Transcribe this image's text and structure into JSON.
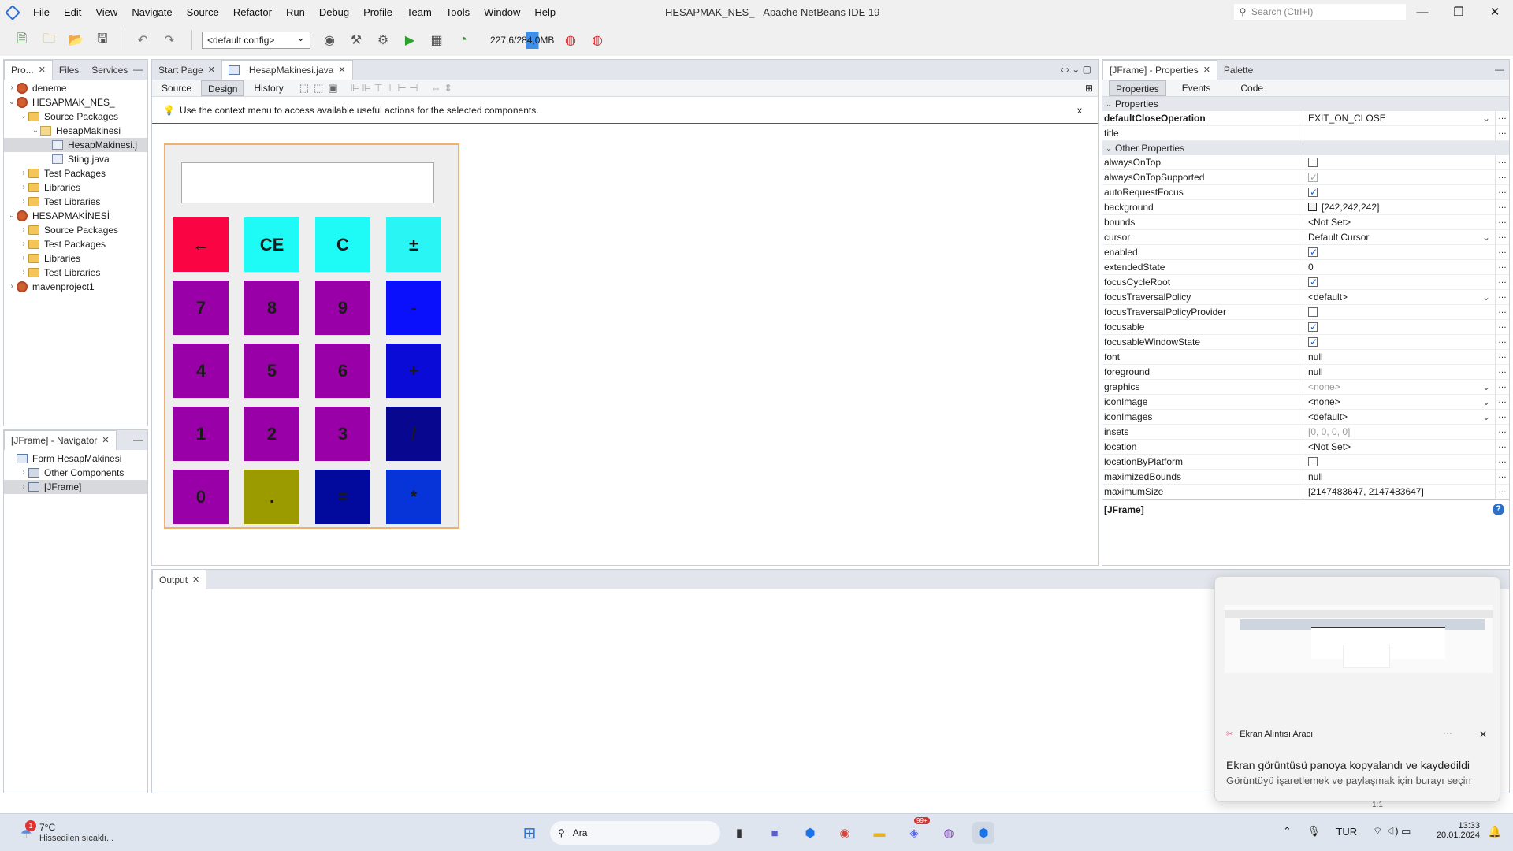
{
  "window": {
    "title": "HESAPMAK_NES_ - Apache NetBeans IDE 19",
    "menus": [
      "File",
      "Edit",
      "View",
      "Navigate",
      "Source",
      "Refactor",
      "Run",
      "Debug",
      "Profile",
      "Team",
      "Tools",
      "Window",
      "Help"
    ],
    "search_placeholder": "Search (Ctrl+I)"
  },
  "toolbar": {
    "config": "<default config>",
    "memory": "227,6/284,0MB"
  },
  "projects_panel": {
    "tabs": [
      "Pro...",
      "Files",
      "Services"
    ],
    "tree": [
      {
        "label": "deneme",
        "icon": "project-icon",
        "level": 0,
        "toggle": "›"
      },
      {
        "label": "HESAPMAK_NES_",
        "icon": "project-icon",
        "level": 0,
        "toggle": "⌄"
      },
      {
        "label": "Source Packages",
        "icon": "folder-icon",
        "level": 1,
        "toggle": "⌄"
      },
      {
        "label": "HesapMakinesi",
        "icon": "package-icon",
        "level": 2,
        "toggle": "⌄"
      },
      {
        "label": "HesapMakinesi.j",
        "icon": "java-file-icon",
        "level": 3,
        "toggle": "",
        "selected": true
      },
      {
        "label": "Sting.java",
        "icon": "java-file-icon",
        "level": 3,
        "toggle": ""
      },
      {
        "label": "Test Packages",
        "icon": "folder-icon",
        "level": 1,
        "toggle": "›"
      },
      {
        "label": "Libraries",
        "icon": "folder-icon",
        "level": 1,
        "toggle": "›"
      },
      {
        "label": "Test Libraries",
        "icon": "folder-icon",
        "level": 1,
        "toggle": "›"
      },
      {
        "label": "HESAPMAKİNESİ",
        "icon": "project-icon",
        "level": 0,
        "toggle": "⌄"
      },
      {
        "label": "Source Packages",
        "icon": "folder-icon",
        "level": 1,
        "toggle": "›"
      },
      {
        "label": "Test Packages",
        "icon": "folder-icon",
        "level": 1,
        "toggle": "›"
      },
      {
        "label": "Libraries",
        "icon": "folder-icon",
        "level": 1,
        "toggle": "›"
      },
      {
        "label": "Test Libraries",
        "icon": "folder-icon",
        "level": 1,
        "toggle": "›"
      },
      {
        "label": "mavenproject1",
        "icon": "project-icon",
        "level": 0,
        "toggle": "›"
      }
    ]
  },
  "navigator": {
    "tab": "[JFrame] - Navigator",
    "tree": [
      {
        "label": "Form HesapMakinesi",
        "icon": "form-icon",
        "level": 0,
        "toggle": ""
      },
      {
        "label": "Other Components",
        "icon": "frame-icon",
        "level": 1,
        "toggle": "›"
      },
      {
        "label": "[JFrame]",
        "icon": "frame-icon",
        "level": 1,
        "toggle": "›",
        "selected": true
      }
    ]
  },
  "editor": {
    "tabs": [
      "Start Page",
      "HesapMakinesi.java"
    ],
    "views": [
      "Source",
      "Design",
      "History"
    ],
    "info": "Use the context menu to access available useful actions for the selected components.",
    "info_close": "x"
  },
  "calculator": {
    "keys": [
      {
        "label": "←",
        "color": "#fb0444"
      },
      {
        "label": "CE",
        "color": "#1efbf6"
      },
      {
        "label": "C",
        "color": "#1efbf6"
      },
      {
        "label": "±",
        "color": "#2af5f5"
      },
      {
        "label": "7",
        "color": "#9a00a7"
      },
      {
        "label": "8",
        "color": "#9a00a7"
      },
      {
        "label": "9",
        "color": "#9a00a7"
      },
      {
        "label": "-",
        "color": "#0a10fb"
      },
      {
        "label": "4",
        "color": "#9a00a7"
      },
      {
        "label": "5",
        "color": "#9a00a7"
      },
      {
        "label": "6",
        "color": "#9a00a7"
      },
      {
        "label": "+",
        "color": "#0a0bd6"
      },
      {
        "label": "1",
        "color": "#9a00a7"
      },
      {
        "label": "2",
        "color": "#9a00a7"
      },
      {
        "label": "3",
        "color": "#9a00a7"
      },
      {
        "label": "/",
        "color": "#07088f"
      },
      {
        "label": "0",
        "color": "#9a00a7"
      },
      {
        "label": ".",
        "color": "#9b9b00"
      },
      {
        "label": "=",
        "color": "#020a9e"
      },
      {
        "label": "*",
        "color": "#0734d9"
      }
    ]
  },
  "properties": {
    "tabs": [
      "[JFrame] - Properties",
      "Palette"
    ],
    "subtabs": [
      "Properties",
      "Events",
      "Code"
    ],
    "section1": "Properties",
    "section2": "Other Properties",
    "rows1": [
      {
        "name": "defaultCloseOperation",
        "value": "EXIT_ON_CLOSE",
        "type": "dropdown",
        "bold": true
      },
      {
        "name": "title",
        "value": "",
        "type": "text"
      }
    ],
    "rows2": [
      {
        "name": "alwaysOnTop",
        "type": "check",
        "checked": false
      },
      {
        "name": "alwaysOnTopSupported",
        "type": "check",
        "checked": true,
        "disabled": true
      },
      {
        "name": "autoRequestFocus",
        "type": "check",
        "checked": true
      },
      {
        "name": "background",
        "value": "[242,242,242]",
        "type": "color"
      },
      {
        "name": "bounds",
        "value": "<Not Set>",
        "type": "text"
      },
      {
        "name": "cursor",
        "value": "Default Cursor",
        "type": "dropdown"
      },
      {
        "name": "enabled",
        "type": "check",
        "checked": true
      },
      {
        "name": "extendedState",
        "value": "0",
        "type": "text"
      },
      {
        "name": "focusCycleRoot",
        "type": "check",
        "checked": true
      },
      {
        "name": "focusTraversalPolicy",
        "value": "<default>",
        "type": "dropdown"
      },
      {
        "name": "focusTraversalPolicyProvider",
        "type": "check",
        "checked": false
      },
      {
        "name": "focusable",
        "type": "check",
        "checked": true
      },
      {
        "name": "focusableWindowState",
        "type": "check",
        "checked": true
      },
      {
        "name": "font",
        "value": "null",
        "type": "text"
      },
      {
        "name": "foreground",
        "value": "null",
        "type": "text"
      },
      {
        "name": "graphics",
        "value": "<none>",
        "type": "grey-dropdown"
      },
      {
        "name": "iconImage",
        "value": "<none>",
        "type": "dropdown"
      },
      {
        "name": "iconImages",
        "value": "<default>",
        "type": "dropdown"
      },
      {
        "name": "insets",
        "value": "[0, 0, 0, 0]",
        "type": "grey"
      },
      {
        "name": "location",
        "value": "<Not Set>",
        "type": "text"
      },
      {
        "name": "locationByPlatform",
        "type": "check",
        "checked": false
      },
      {
        "name": "maximizedBounds",
        "value": "null",
        "type": "text"
      },
      {
        "name": "maximumSize",
        "value": "[2147483647, 2147483647]",
        "type": "text"
      }
    ],
    "footer": "[JFrame]"
  },
  "output": {
    "tab": "Output"
  },
  "toast": {
    "app": "Ekran Alıntısı Aracı",
    "title": "Ekran görüntüsü panoya kopyalandı ve kaydedildi",
    "subtitle": "Görüntüyü işaretlemek ve paylaşmak için burayı seçin",
    "more": "···",
    "close": "✕",
    "behind_text": "1:1"
  },
  "taskbar": {
    "weather_temp": "7°C",
    "weather_desc": "Hissedilen sıcaklı...",
    "weather_badge": "1",
    "search": "Ara",
    "lang": "TUR",
    "time": "13:33",
    "date": "20.01.2024",
    "badge": "99+"
  }
}
